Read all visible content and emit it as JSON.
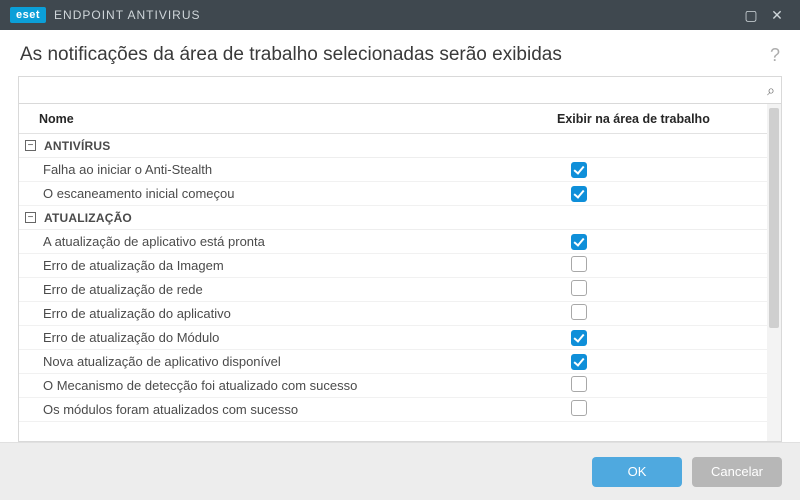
{
  "titlebar": {
    "brand_badge": "eset",
    "brand_text": "ENDPOINT ANTIVIRUS"
  },
  "heading": {
    "title": "As notificações da área de trabalho selecionadas serão exibidas"
  },
  "search": {
    "placeholder": ""
  },
  "columns": {
    "name": "Nome",
    "show": "Exibir na área de trabalho"
  },
  "groups": [
    {
      "label": "ANTIVÍRUS",
      "expanded": true,
      "rows": [
        {
          "name": "Falha ao iniciar o Anti-Stealth",
          "checked": true
        },
        {
          "name": "O escaneamento inicial começou",
          "checked": true
        }
      ]
    },
    {
      "label": "ATUALIZAÇÃO",
      "expanded": true,
      "rows": [
        {
          "name": "A atualização de aplicativo está pronta",
          "checked": true
        },
        {
          "name": "Erro de atualização da Imagem",
          "checked": false
        },
        {
          "name": "Erro de atualização de rede",
          "checked": false
        },
        {
          "name": "Erro de atualização do aplicativo",
          "checked": false
        },
        {
          "name": "Erro de atualização do Módulo",
          "checked": true
        },
        {
          "name": "Nova atualização de aplicativo disponível",
          "checked": true
        },
        {
          "name": "O Mecanismo de detecção foi atualizado com sucesso",
          "checked": false
        },
        {
          "name": "Os módulos foram atualizados com sucesso",
          "checked": false
        }
      ]
    }
  ],
  "footer": {
    "ok": "OK",
    "cancel": "Cancelar"
  },
  "icons": {
    "minus": "−",
    "help": "?",
    "minimize": "▢",
    "close": "✕",
    "search": "⌕"
  }
}
